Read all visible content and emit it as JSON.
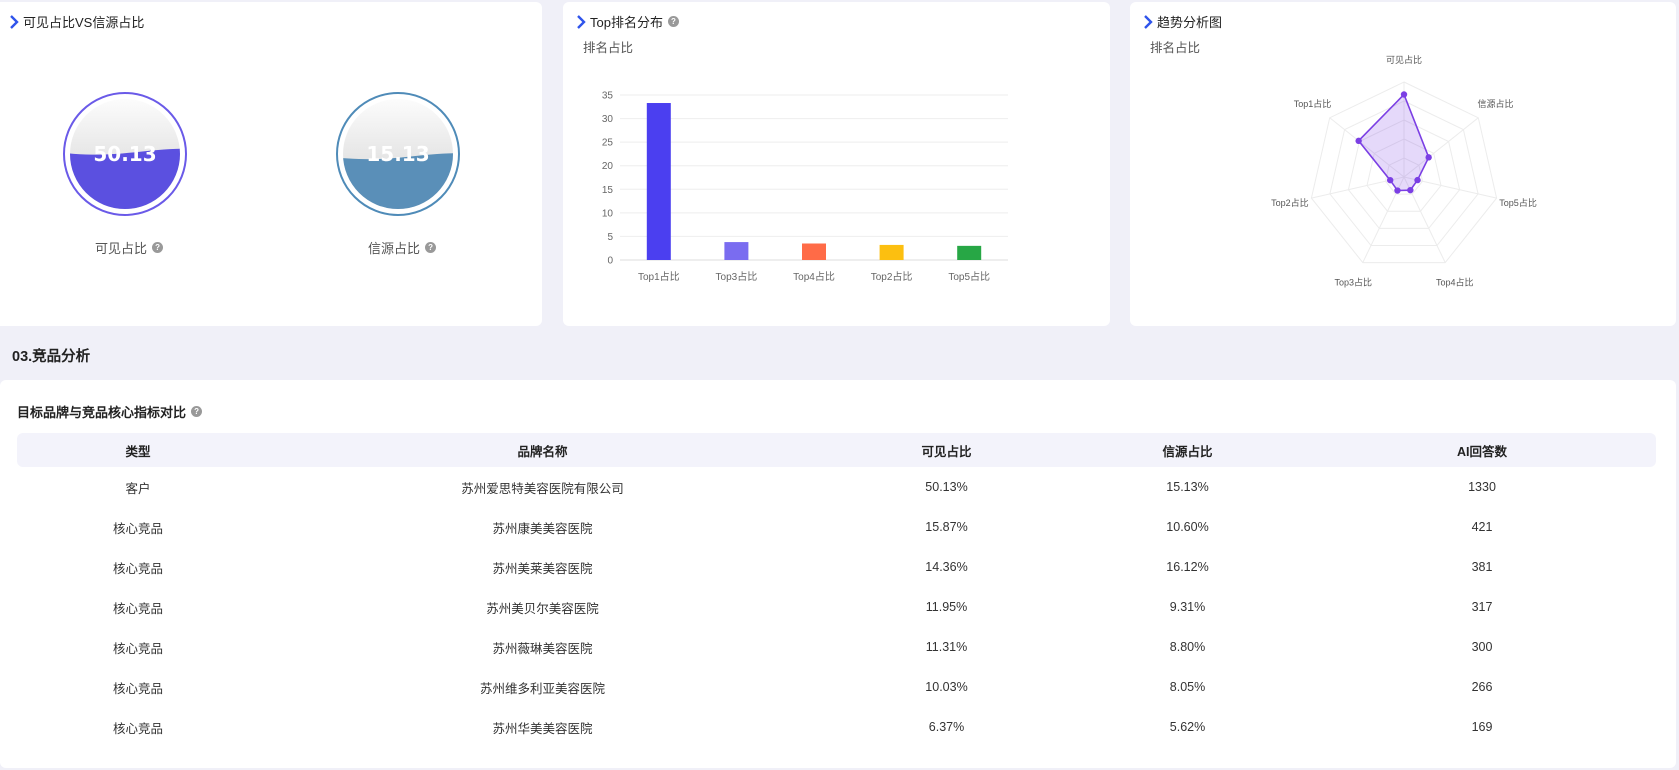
{
  "gauge_card": {
    "title": "可见占比VS信源占比",
    "gauges": [
      {
        "value": "50.13",
        "fill_percent": 50.13,
        "label": "可见占比",
        "color": "#5b50e0",
        "ring_color": "#6a5ae8"
      },
      {
        "value": "15.13",
        "fill_percent": 15.13,
        "label": "信源占比",
        "color": "#5a8fb8",
        "ring_color": "#4f8bb8"
      }
    ]
  },
  "top_card": {
    "title": "Top排名分布",
    "subtitle": "排名占比"
  },
  "trend_card": {
    "title": "趋势分析图",
    "subtitle": "排名占比"
  },
  "chart_data": [
    {
      "type": "bar",
      "title": "",
      "categories": [
        "Top1占比",
        "Top3占比",
        "Top4占比",
        "Top2占比",
        "Top5占比"
      ],
      "values": [
        33.3,
        3.8,
        3.5,
        3.2,
        3.0
      ],
      "colors": [
        "#4b3ff0",
        "#7a6cf0",
        "#ff6b47",
        "#fcbf10",
        "#27a745"
      ],
      "y_ticks": [
        0,
        5,
        10,
        15,
        20,
        25,
        30,
        35
      ],
      "ylim": [
        0,
        35
      ],
      "grid": true
    },
    {
      "type": "radar",
      "title": "",
      "axes": [
        "可见占比",
        "信源占比",
        "Top5占比",
        "Top4占比",
        "Top3占比",
        "Top2占比",
        "Top1占比"
      ],
      "values": [
        50.13,
        15.13,
        3.0,
        3.5,
        3.8,
        3.2,
        33.3
      ],
      "max": 60,
      "color": "#7b3fe4"
    }
  ],
  "section": {
    "title": "03.竞品分析"
  },
  "table_card": {
    "title": "目标品牌与竞品核心指标对比",
    "headers": [
      "类型",
      "品牌名称",
      "可见占比",
      "信源占比",
      "AI回答数"
    ],
    "rows": [
      [
        "客户",
        "苏州爱思特美容医院有限公司",
        "50.13%",
        "15.13%",
        "1330"
      ],
      [
        "核心竞品",
        "苏州康美美容医院",
        "15.87%",
        "10.60%",
        "421"
      ],
      [
        "核心竞品",
        "苏州美莱美容医院",
        "14.36%",
        "16.12%",
        "381"
      ],
      [
        "核心竞品",
        "苏州美贝尔美容医院",
        "11.95%",
        "9.31%",
        "317"
      ],
      [
        "核心竞品",
        "苏州薇琳美容医院",
        "11.31%",
        "8.80%",
        "300"
      ],
      [
        "核心竞品",
        "苏州维多利亚美容医院",
        "10.03%",
        "8.05%",
        "266"
      ],
      [
        "核心竞品",
        "苏州华美美容医院",
        "6.37%",
        "5.62%",
        "169"
      ]
    ]
  }
}
